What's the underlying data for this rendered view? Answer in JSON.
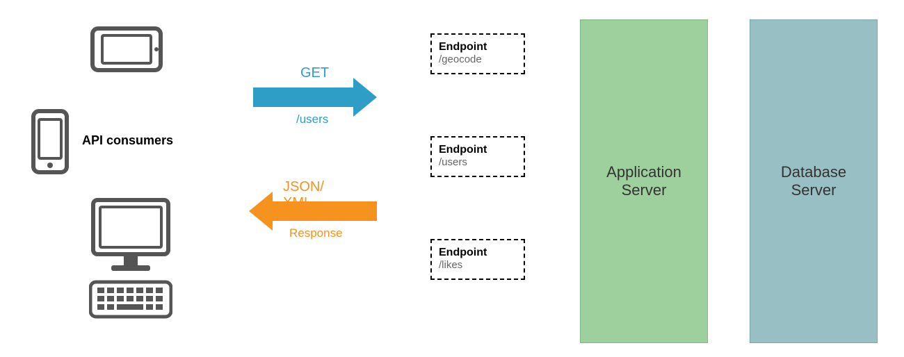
{
  "consumers_label": "API consumers",
  "request": {
    "method": "GET",
    "path": "/users"
  },
  "response": {
    "format": "JSON/ XML",
    "label": "Response"
  },
  "endpoints": [
    {
      "title": "Endpoint",
      "path": "/geocode"
    },
    {
      "title": "Endpoint",
      "path": "/users"
    },
    {
      "title": "Endpoint",
      "path": "/likes"
    }
  ],
  "servers": {
    "app": "Application\nServer",
    "db": "Database\nServer"
  }
}
